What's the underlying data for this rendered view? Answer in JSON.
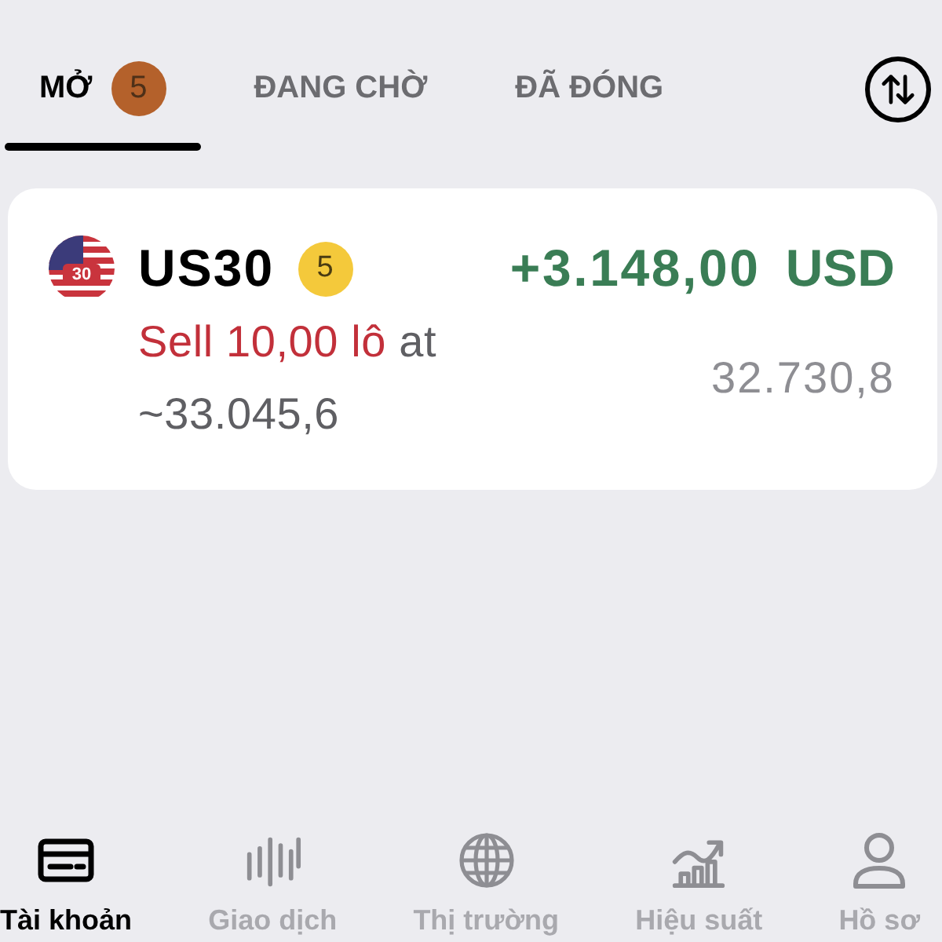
{
  "tabs": [
    {
      "label": "MỞ",
      "badge": "5",
      "selected": true
    },
    {
      "label": "ĐANG CHỜ",
      "selected": false
    },
    {
      "label": "ĐÃ ĐÓNG",
      "selected": false
    }
  ],
  "positions": [
    {
      "symbol": "US30",
      "flag_label": "30",
      "badge": "5",
      "profit": "+3.148,00",
      "currency": "USD",
      "order": "Sell 10,00 lô",
      "entry": "at ~33.045,6",
      "current_price": "32.730,8"
    }
  ],
  "bottom_nav": [
    {
      "label": "Tài khoản",
      "selected": true
    },
    {
      "label": "Giao dịch",
      "selected": false
    },
    {
      "label": "Thị trường",
      "selected": false
    },
    {
      "label": "Hiệu suất",
      "selected": false
    },
    {
      "label": "Hồ sơ",
      "selected": false
    }
  ]
}
